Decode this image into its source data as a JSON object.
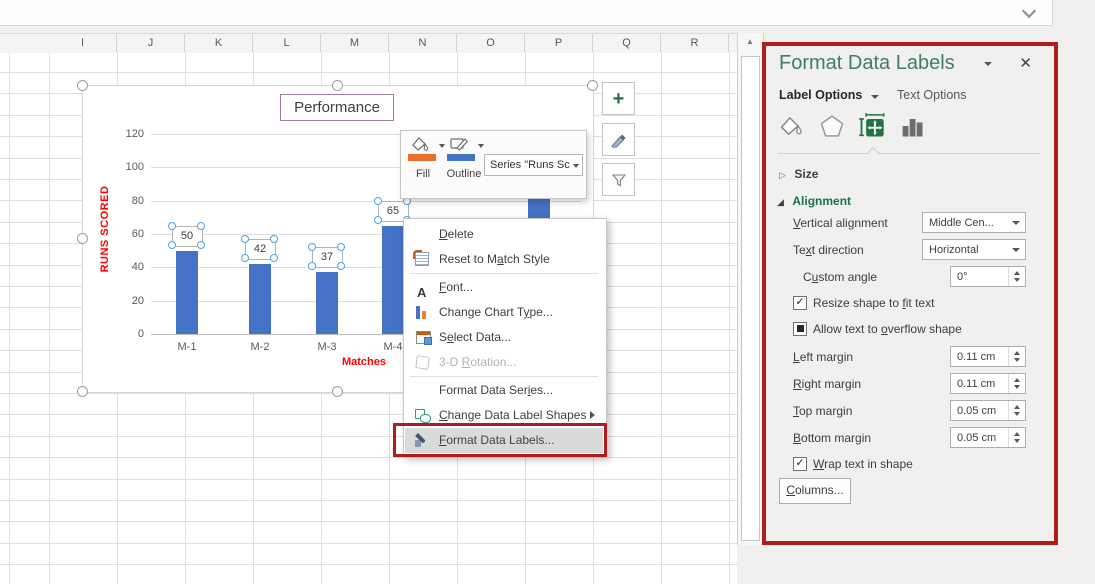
{
  "colors": {
    "excel_green": "#217346",
    "pane_title_green": "#3f7d65",
    "bar_blue": "#4472c4",
    "annotation_red": "#b01c1c",
    "axis_title_red": "#ff0000",
    "fill_swatch_orange": "#e8702a",
    "outline_swatch_blue": "#4472c4",
    "chart_title_fill": "#fbcfa9",
    "chart_title_border": "#a07d9c"
  },
  "topbar": {
    "collapse_icon": "chevron-down-icon"
  },
  "spreadsheet": {
    "column_headers": [
      "I",
      "J",
      "K",
      "L",
      "M",
      "N",
      "O",
      "P",
      "Q",
      "R"
    ]
  },
  "chart_data": {
    "type": "bar",
    "title": "Performance",
    "categories": [
      "M-1",
      "M-2",
      "M-3",
      "M-4"
    ],
    "values": [
      50,
      42,
      37,
      65
    ],
    "xlabel": "Matches",
    "ylabel": "RUNS SCORED",
    "ylim": [
      0,
      120
    ],
    "yticks": [
      0,
      20,
      40,
      60,
      80,
      100,
      120
    ],
    "grid": true,
    "data_labels_shown": true,
    "note": "a further bar is partially visible behind the context menu"
  },
  "chart_buttons": [
    "chart-elements-plus-icon",
    "chart-styles-brush-icon",
    "chart-filters-funnel-icon"
  ],
  "mini_toolbar": {
    "fill_label": "Fill",
    "outline_label": "Outline",
    "series_selector": "Series \"Runs Sc"
  },
  "context_menu": {
    "items": [
      {
        "name": "delete",
        "pre": "",
        "key": "D",
        "post": "elete",
        "icon": null
      },
      {
        "name": "reset-to-match-style",
        "pre": "Reset to M",
        "key": "a",
        "post": "tch Style",
        "icon": "reset-style-icon"
      },
      {
        "sep": true
      },
      {
        "name": "font",
        "pre": "",
        "key": "F",
        "post": "ont...",
        "icon": "font-icon"
      },
      {
        "name": "change-chart-type",
        "pre": "Change Chart T",
        "key": "y",
        "post": "pe...",
        "icon": "chart-type-icon"
      },
      {
        "name": "select-data",
        "pre": "S",
        "key": "e",
        "post": "lect Data...",
        "icon": "select-data-icon"
      },
      {
        "name": "3d-rotation",
        "pre": "3-D ",
        "key": "R",
        "post": "otation...",
        "icon": "cube-icon",
        "disabled": true
      },
      {
        "sep": true
      },
      {
        "name": "format-data-series",
        "pre": "Format Data Ser",
        "key": "i",
        "post": "es...",
        "icon": null
      },
      {
        "name": "change-data-label-shapes",
        "pre": "",
        "key": "C",
        "post": "hange Data Label Shapes",
        "icon": "shapes-icon",
        "submenu": true
      },
      {
        "name": "format-data-labels",
        "pre": "",
        "key": "F",
        "post": "ormat Data Labels...",
        "icon": "format-labels-icon",
        "highlighted": true
      }
    ]
  },
  "task_pane": {
    "title": "Format Data Labels",
    "tabs": [
      {
        "label": "Label Options",
        "selected": true
      },
      {
        "label": "Text Options",
        "selected": false
      }
    ],
    "icon_tabs": [
      "fill-line-icon",
      "effects-icon",
      "size-properties-icon",
      "label-options-icon"
    ],
    "selected_icon_tab": "size-properties-icon",
    "size_section": {
      "label": "Size",
      "expanded": false
    },
    "alignment_section": {
      "label": "Alignment",
      "expanded": true,
      "vertical_alignment": {
        "pre": "",
        "key": "V",
        "post": "ertical alignment",
        "value": "Middle Cen..."
      },
      "text_direction": {
        "pre": "Te",
        "key": "x",
        "post": "t direction",
        "value": "Horizontal"
      },
      "custom_angle": {
        "pre": "C",
        "key": "u",
        "post": "stom angle",
        "value": "0°"
      },
      "resize_shape": {
        "pre": "Resize shape to ",
        "key": "f",
        "post": "it text",
        "checked": true
      },
      "allow_overflow": {
        "pre": "Allow text to ",
        "key": "o",
        "post": "verflow shape",
        "checked": "mixed"
      },
      "left_margin": {
        "pre": "",
        "key": "L",
        "post": "eft margin",
        "value": "0.11 cm"
      },
      "right_margin": {
        "pre": "",
        "key": "R",
        "post": "ight margin",
        "value": "0.11 cm"
      },
      "top_margin": {
        "pre": "",
        "key": "T",
        "post": "op margin",
        "value": "0.05 cm"
      },
      "bottom_margin": {
        "pre": "",
        "key": "B",
        "post": "ottom margin",
        "value": "0.05 cm"
      },
      "wrap_text": {
        "pre": "",
        "key": "W",
        "post": "rap text in shape",
        "checked": true
      },
      "columns_button": {
        "pre": "",
        "key": "C",
        "post": "olumns..."
      }
    }
  }
}
